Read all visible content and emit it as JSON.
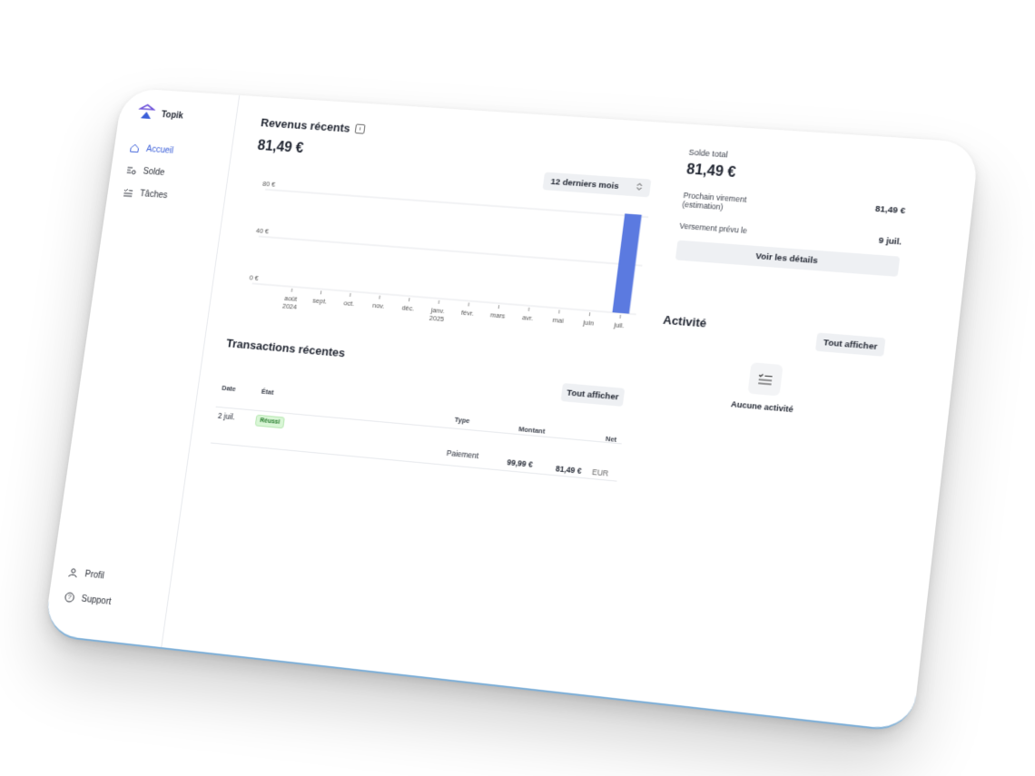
{
  "app": {
    "name": "Topik"
  },
  "sidebar": {
    "items": [
      {
        "label": "Accueil",
        "icon": "home-icon",
        "active": true
      },
      {
        "label": "Solde",
        "icon": "balance-icon",
        "active": false
      },
      {
        "label": "Tâches",
        "icon": "tasks-icon",
        "active": false
      }
    ],
    "bottom": [
      {
        "label": "Profil",
        "icon": "user-icon"
      },
      {
        "label": "Support",
        "icon": "help-icon"
      }
    ]
  },
  "revenue": {
    "title": "Revenus récents",
    "amount": "81,49 €",
    "period": "12 derniers mois"
  },
  "chart_data": {
    "type": "bar",
    "categories": [
      "août 2024",
      "sept.",
      "oct.",
      "nov.",
      "déc.",
      "janv. 2025",
      "févr.",
      "mars",
      "avr.",
      "mai",
      "juin",
      "juil."
    ],
    "category_lines": [
      [
        "août",
        "2024"
      ],
      [
        "sept."
      ],
      [
        "oct."
      ],
      [
        "nov."
      ],
      [
        "déc."
      ],
      [
        "janv.",
        "2025"
      ],
      [
        "févr."
      ],
      [
        "mars"
      ],
      [
        "avr."
      ],
      [
        "mai"
      ],
      [
        "juin"
      ],
      [
        "juil."
      ]
    ],
    "values": [
      0,
      0,
      0,
      0,
      0,
      0,
      0,
      0,
      0,
      0,
      0,
      81.49
    ],
    "y_ticks": [
      "0 €",
      "40 €",
      "80 €"
    ],
    "y_tick_values": [
      0,
      40,
      80
    ],
    "ylim": [
      0,
      80
    ],
    "grid": true,
    "bar_color": "#5b7ae0"
  },
  "transactions": {
    "title": "Transactions récentes",
    "view_all": "Tout afficher",
    "headers": {
      "date": "Date",
      "state": "État",
      "type": "Type",
      "amount": "Montant",
      "net": "Net"
    },
    "rows": [
      {
        "date": "2 juil.",
        "state": "Réussi",
        "type": "Paiement",
        "amount": "99,99 €",
        "net": "81,49 €",
        "currency": "EUR"
      }
    ]
  },
  "summary": {
    "total_label": "Solde total",
    "total_amount": "81,49 €",
    "next_transfer_label": "Prochain virement (estimation)",
    "next_transfer_value": "81,49 €",
    "payout_label": "Versement prévu le",
    "payout_value": "9 juil.",
    "details_button": "Voir les détails"
  },
  "activity": {
    "title": "Activité",
    "view_all": "Tout afficher",
    "empty": "Aucune activité"
  },
  "colors": {
    "accent": "#3b5fd9",
    "success_bg": "#d9f6d6",
    "success_text": "#247a2a"
  }
}
